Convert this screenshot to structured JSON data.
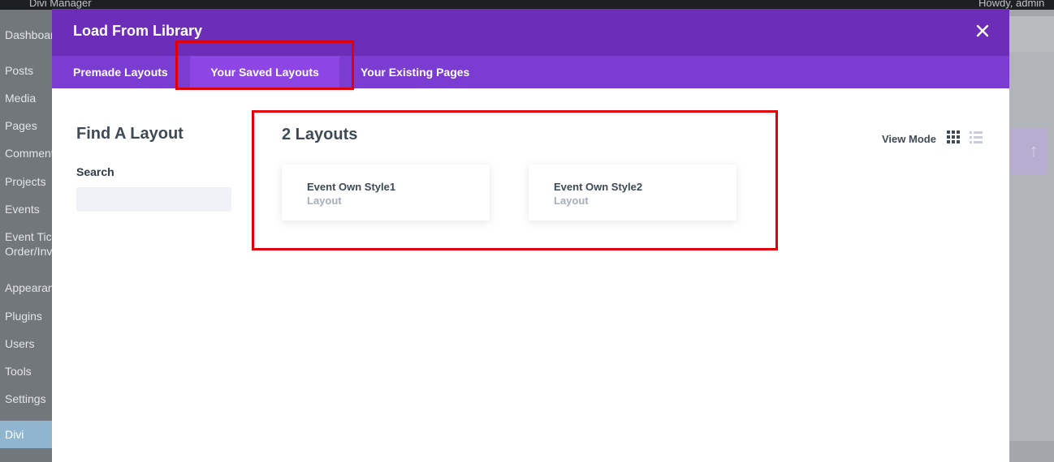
{
  "background": {
    "topbar_left_text": "Divi Manager",
    "topbar_right_text": "Howdy, admin",
    "sidebar": {
      "items": [
        {
          "label": "Dashboard"
        },
        {
          "label": "Posts"
        },
        {
          "label": "Media"
        },
        {
          "label": "Pages"
        },
        {
          "label": "Comments"
        },
        {
          "label": "Projects"
        },
        {
          "label": "Events"
        },
        {
          "label": "Event Tickets"
        },
        {
          "label": "Order/Invoices"
        },
        {
          "label": "Appearance"
        },
        {
          "label": "Plugins"
        },
        {
          "label": "Users"
        },
        {
          "label": "Tools"
        },
        {
          "label": "Settings"
        },
        {
          "label": "Divi"
        }
      ]
    }
  },
  "modal": {
    "title": "Load From Library",
    "close_icon": "close-icon",
    "tabs": [
      {
        "label": "Premade Layouts",
        "active": false
      },
      {
        "label": "Your Saved Layouts",
        "active": true
      },
      {
        "label": "Your Existing Pages",
        "active": false
      }
    ],
    "filter": {
      "title": "Find A Layout",
      "search_label": "Search",
      "search_value": "",
      "search_placeholder": ""
    },
    "results": {
      "count_title": "2 Layouts",
      "view_mode_label": "View Mode",
      "view_modes": [
        "grid-icon",
        "list-icon"
      ],
      "active_view_mode": "grid",
      "layouts": [
        {
          "name": "Event Own Style1",
          "type": "Layout"
        },
        {
          "name": "Event Own Style2",
          "type": "Layout"
        }
      ]
    }
  },
  "colors": {
    "header": "#6c2eb9",
    "tabs_bar": "#7b3cd2",
    "active_tab": "#8d45e4",
    "annotation": "#e0000a"
  }
}
